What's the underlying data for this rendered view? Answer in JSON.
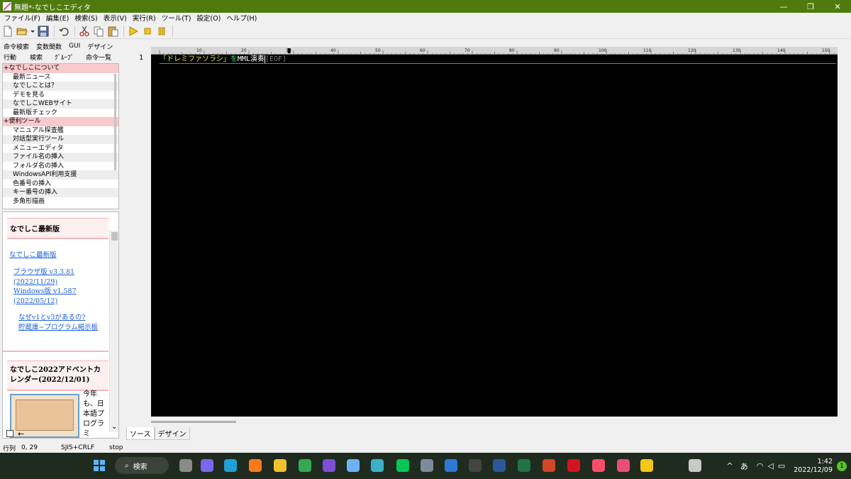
{
  "window": {
    "title": "無題*-なでしこエディタ",
    "controls": [
      "—",
      "❐",
      "✕"
    ]
  },
  "menu": [
    "ファイル(F)",
    "編集(E)",
    "検索(S)",
    "表示(V)",
    "実行(R)",
    "ツール(T)",
    "設定(O)",
    "ヘルプ(H)"
  ],
  "toolbar": [
    "new-file",
    "open-folder",
    "dropdown",
    "save",
    "undo",
    "cut",
    "copy",
    "paste",
    "run",
    "stop",
    "pause"
  ],
  "lefttabs": {
    "row1": [
      "命令検索",
      "変数関数",
      "GUI",
      "デザイン"
    ],
    "row2": [
      "行動",
      "検索",
      "ｸﾞﾙｰﾌﾟ",
      "命令一覧"
    ]
  },
  "tree": [
    {
      "label": "+なでしこについて",
      "type": "cat"
    },
    {
      "label": "最新ニュース",
      "type": "item"
    },
    {
      "label": "なでしことは？",
      "type": "alt"
    },
    {
      "label": "デモを見る",
      "type": "item"
    },
    {
      "label": "なでしこWEBサイト",
      "type": "alt"
    },
    {
      "label": "最新版チェック",
      "type": "item"
    },
    {
      "label": "+便利ツール",
      "type": "cat"
    },
    {
      "label": "マニュアル探査艦",
      "type": "item"
    },
    {
      "label": "対話型実行ツール",
      "type": "alt"
    },
    {
      "label": "メニューエディタ",
      "type": "item"
    },
    {
      "label": "ファイル名の挿入",
      "type": "alt"
    },
    {
      "label": "フォルダ名の挿入",
      "type": "item"
    },
    {
      "label": "WindowsAPI利用支援",
      "type": "alt"
    },
    {
      "label": "色番号の挿入",
      "type": "item"
    },
    {
      "label": "キー番号の挿入",
      "type": "alt"
    },
    {
      "label": "多角形描画",
      "type": "item"
    }
  ],
  "news": {
    "section1_title": "なでしこ最新版",
    "link_main": "なでしこ最新版",
    "browser_ver": "ブラウザ版 v3.3.81",
    "browser_date": "(2022/11/29)",
    "windows_ver": "Windows版 v1.587",
    "windows_date": "(2022/05/12)",
    "why_link": "なぜv1とv3があるの?",
    "board_link": "貯蔵庫−プログラム掲示板",
    "section2_title": "なでしこ2022アドベントカレンダー(2022/12/01)",
    "body_text": "今年も、日本語プログラミ"
  },
  "editor": {
    "ruler_marks": [
      "10",
      "20",
      "30",
      "40",
      "50",
      "60",
      "70",
      "80",
      "90",
      "100",
      "110",
      "120",
      "130",
      "140",
      "150"
    ],
    "line_number": "1",
    "code_str": "「ドレミファソラシ」",
    "code_kw": "を",
    "code_rest": "MML演奏",
    "eof": "[EOF]"
  },
  "bottom_tabs": [
    "ソース",
    "デザイン"
  ],
  "status": {
    "pos_label": "行列",
    "pos_value": "0, 29",
    "encoding": "SJIS+CRLF",
    "state": "stop"
  },
  "taskbar": {
    "search_label": "検索",
    "apps": [
      "explorer-gray",
      "meet",
      "edge",
      "firefox",
      "files",
      "chrome",
      "vs",
      "notepad",
      "maps",
      "line",
      "calculator",
      "outlook",
      "media",
      "word",
      "excel",
      "powerpoint",
      "acrobat",
      "music",
      "photos",
      "duck",
      "nadesiko"
    ],
    "ime": "あ",
    "time": "1:42",
    "date": "2022/12/09",
    "notify_count": "1"
  },
  "colors": {
    "titlebar": "#4f7b0e",
    "category_bg": "#f8c9cd",
    "editor_bg": "#000000",
    "string": "#e8e830",
    "keyword": "#2ee060"
  }
}
